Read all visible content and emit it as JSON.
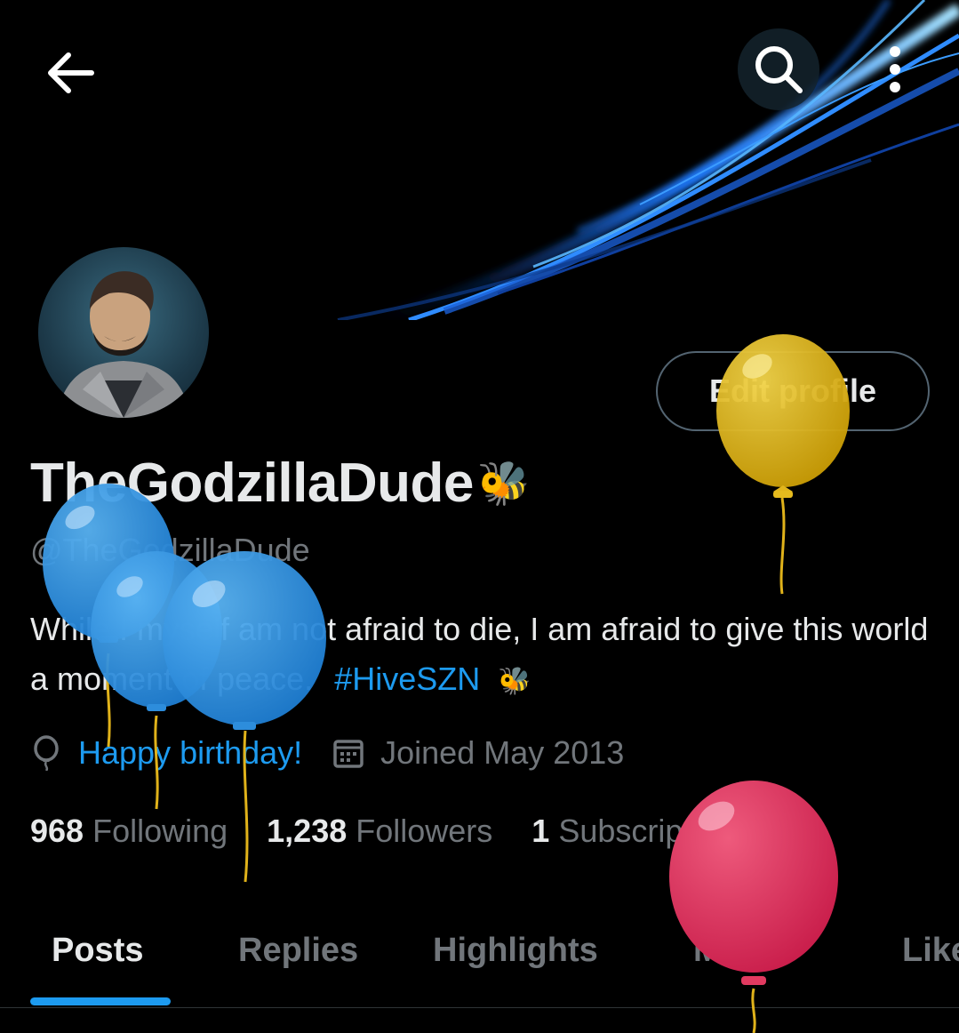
{
  "header": {
    "back_icon": "arrow-left-icon",
    "search_icon": "search-icon",
    "more_icon": "more-vertical-icon"
  },
  "profile": {
    "display_name": "TheGodzillaDude",
    "name_emoji": "🐝",
    "handle": "@TheGodzillaDude",
    "bio_text": "While I myself am not afraid to die, I am afraid to give this world a moment of peace.",
    "bio_hashtag": "#HiveSZN",
    "bio_emoji": "🐝",
    "edit_button_label": "Edit profile"
  },
  "meta": {
    "birthday_icon": "balloon-icon",
    "birthday_text": "Happy birthday!",
    "joined_icon": "calendar-icon",
    "joined_text": "Joined May 2013"
  },
  "stats": {
    "following_count": "968",
    "following_label": "Following",
    "followers_count": "1,238",
    "followers_label": "Followers",
    "subscriptions_count": "1",
    "subscriptions_label": "Subscription"
  },
  "tabs": [
    {
      "label": "Posts",
      "active": true
    },
    {
      "label": "Replies",
      "active": false
    },
    {
      "label": "Highlights",
      "active": false
    },
    {
      "label": "Media",
      "active": false
    },
    {
      "label": "Likes",
      "active": false
    }
  ],
  "colors": {
    "accent": "#1d9bf0",
    "secondary_text": "#71767b",
    "primary_text": "#e7e9ea",
    "background": "#000000"
  }
}
